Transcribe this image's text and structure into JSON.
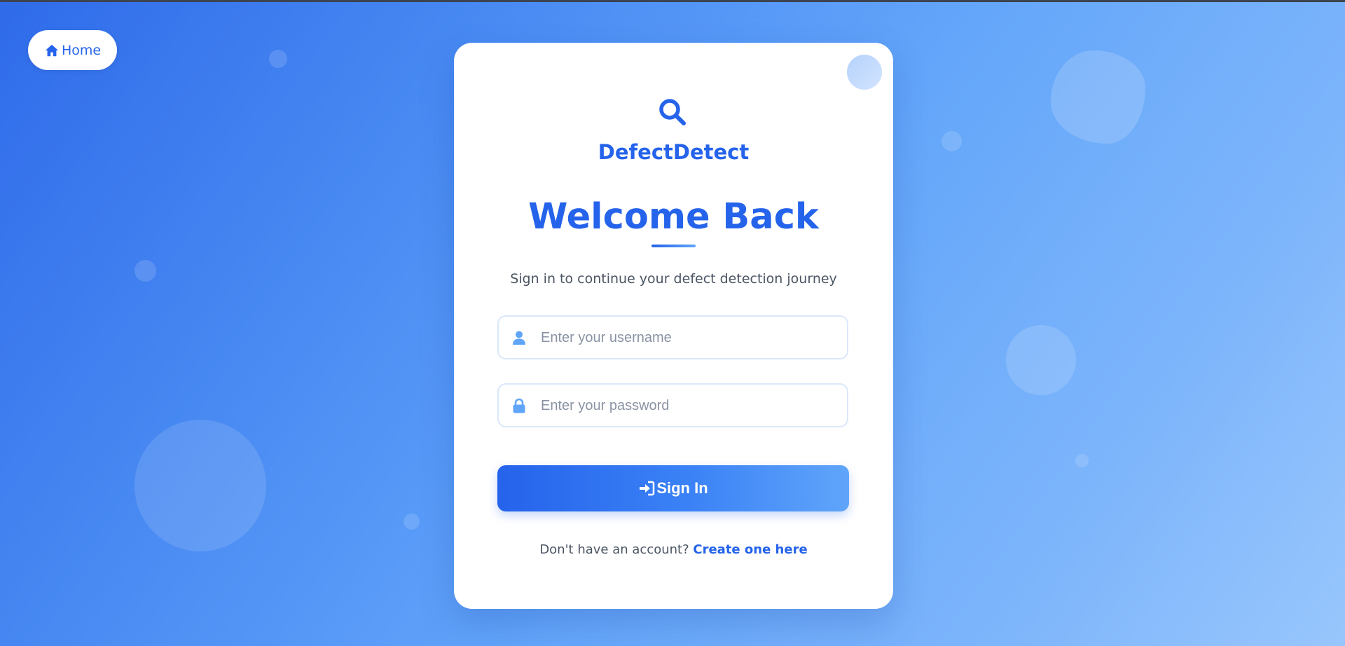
{
  "nav": {
    "home_label": "Home"
  },
  "brand": {
    "name": "DefectDetect",
    "icon": "search-icon"
  },
  "login": {
    "title": "Welcome Back",
    "subtitle": "Sign in to continue your defect detection journey",
    "username": {
      "placeholder": "Enter your username",
      "value": "",
      "icon": "user-icon"
    },
    "password": {
      "placeholder": "Enter your password",
      "value": "",
      "icon": "lock-icon"
    },
    "submit_label": "Sign In",
    "submit_icon": "sign-in-icon",
    "register_prompt": "Don't have an account?",
    "register_link": "Create one here"
  },
  "colors": {
    "accent": "#2563eb",
    "accent_light": "#60a5fa",
    "text_muted": "#4b5563",
    "background_start": "#2f6bea",
    "background_end": "#98c6fc"
  }
}
